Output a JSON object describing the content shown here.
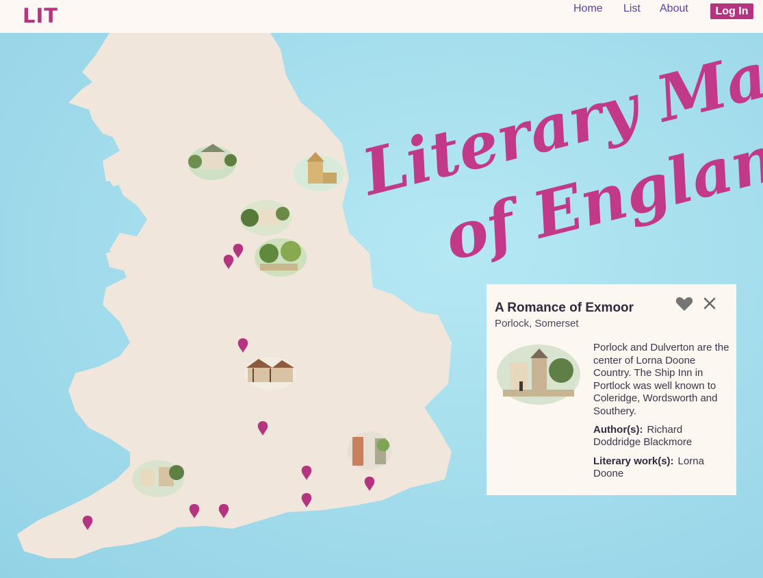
{
  "header": {
    "logo": "LIT",
    "nav": [
      "Home",
      "List",
      "About"
    ],
    "login_label": "Log In"
  },
  "map": {
    "title_line1": "Literary Map",
    "title_line2": "of England",
    "colors": {
      "sea": "#a2dcec",
      "land": "#f1e6dc",
      "pin": "#b5347f",
      "title": "#c2398a"
    }
  },
  "card": {
    "title": "A Romance of Exmoor",
    "location": "Porlock, Somerset",
    "description": "Porlock and Dulverton are the center of Lorna Doone Country. The Ship Inn in Portlock was well known to Coleridge, Wordsworth and Southery.",
    "author_label": "Author(s):",
    "author": "Richard Doddridge Blackmore",
    "work_label": "Literary work(s):",
    "work": "Lorna Doone",
    "favorite_icon": "heart-icon",
    "close_icon": "close-icon"
  }
}
